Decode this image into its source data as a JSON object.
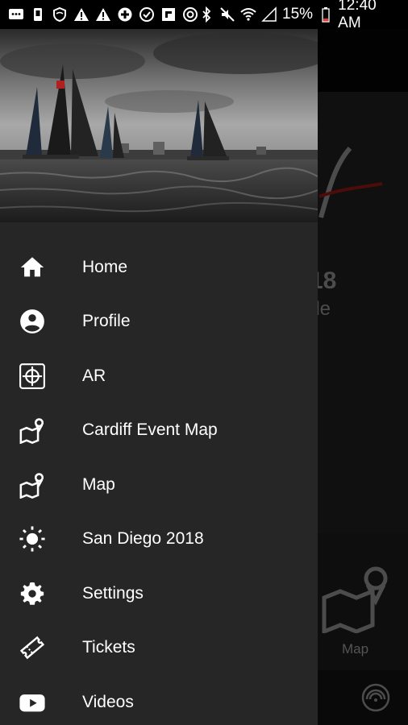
{
  "status_bar": {
    "battery_percent": "15%",
    "time": "12:40 AM",
    "left_icons": [
      "message-icon",
      "sim-icon",
      "shield-icon",
      "warning-icon",
      "warning-icon",
      "plus-circle-icon",
      "check-circle-icon",
      "flipboard-icon",
      "record-icon"
    ],
    "right_icons": [
      "bluetooth-icon",
      "mute-icon",
      "wifi-icon",
      "signal-icon",
      "battery-low-icon"
    ]
  },
  "drawer": {
    "menu": [
      {
        "label": "Home",
        "icon": "home-icon"
      },
      {
        "label": "Profile",
        "icon": "account-circle-icon"
      },
      {
        "label": "AR",
        "icon": "ar-crosshair-icon"
      },
      {
        "label": "Cardiff Event Map",
        "icon": "map-pin-icon"
      },
      {
        "label": "Map",
        "icon": "map-pin-icon"
      },
      {
        "label": "San Diego 2018",
        "icon": "sun-icon"
      },
      {
        "label": "Settings",
        "icon": "gear-icon"
      },
      {
        "label": "Tickets",
        "icon": "ticket-icon"
      },
      {
        "label": "Videos",
        "icon": "youtube-icon"
      }
    ]
  },
  "background_app": {
    "headline": "18",
    "subline": "ole",
    "subline2": "",
    "map_tab_label": "Map"
  },
  "colors": {
    "drawer_bg": "#262626",
    "accent_red": "#c0201a"
  }
}
